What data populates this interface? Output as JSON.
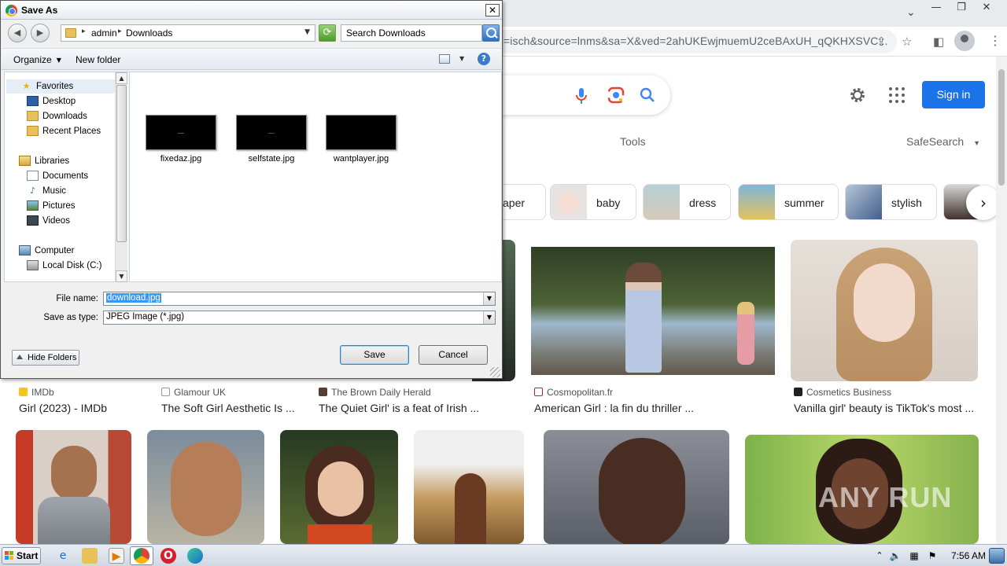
{
  "browser": {
    "url_fragment": "=isch&source=lnms&sa=X&ved=2ahUKEwjmuemU2ceBAxUH_qQKHXSVC...",
    "sign_in_label": "Sign in",
    "tools_label": "Tools",
    "safesearch_label": "SafeSearch",
    "accent_color": "#1a73e8",
    "chips": [
      {
        "label": "aper"
      },
      {
        "label": "baby"
      },
      {
        "label": "dress"
      },
      {
        "label": "summer"
      },
      {
        "label": "stylish"
      }
    ],
    "results_row1": [
      {
        "source": "IMDb",
        "caption": "Girl (2023) - IMDb"
      },
      {
        "source": "Glamour UK",
        "caption": "The Soft Girl Aesthetic Is ..."
      },
      {
        "source": "The Brown Daily Herald",
        "caption": "The Quiet Girl' is a feat of Irish ..."
      },
      {
        "source": "Cosmopolitan.fr",
        "caption": "American Girl : la fin du thriller ..."
      },
      {
        "source": "Cosmetics Business",
        "caption": "Vanilla girl' beauty is TikTok's most ..."
      }
    ],
    "watermark": "ANY RUN"
  },
  "dialog": {
    "title": "Save As",
    "close_label": "✕",
    "breadcrumb": [
      "admin",
      "Downloads"
    ],
    "search_placeholder": "Search Downloads",
    "toolbar": {
      "organize": "Organize",
      "new_folder": "New folder",
      "help": "?"
    },
    "nav": {
      "favorites": "Favorites",
      "desktop": "Desktop",
      "downloads": "Downloads",
      "recent_places": "Recent Places",
      "libraries": "Libraries",
      "documents": "Documents",
      "music": "Music",
      "pictures": "Pictures",
      "videos": "Videos",
      "computer": "Computer",
      "local_disk": "Local Disk (C:)"
    },
    "files": [
      {
        "name": "fixedaz.jpg"
      },
      {
        "name": "selfstate.jpg"
      },
      {
        "name": "wantplayer.jpg"
      }
    ],
    "file_name_label": "File name:",
    "file_name_value": "download.jpg",
    "save_type_label": "Save as type:",
    "save_type_value": "JPEG Image (*.jpg)",
    "hide_folders_label": "Hide Folders",
    "save_label": "Save",
    "cancel_label": "Cancel"
  },
  "taskbar": {
    "start_label": "Start",
    "clock": "7:56 AM"
  }
}
